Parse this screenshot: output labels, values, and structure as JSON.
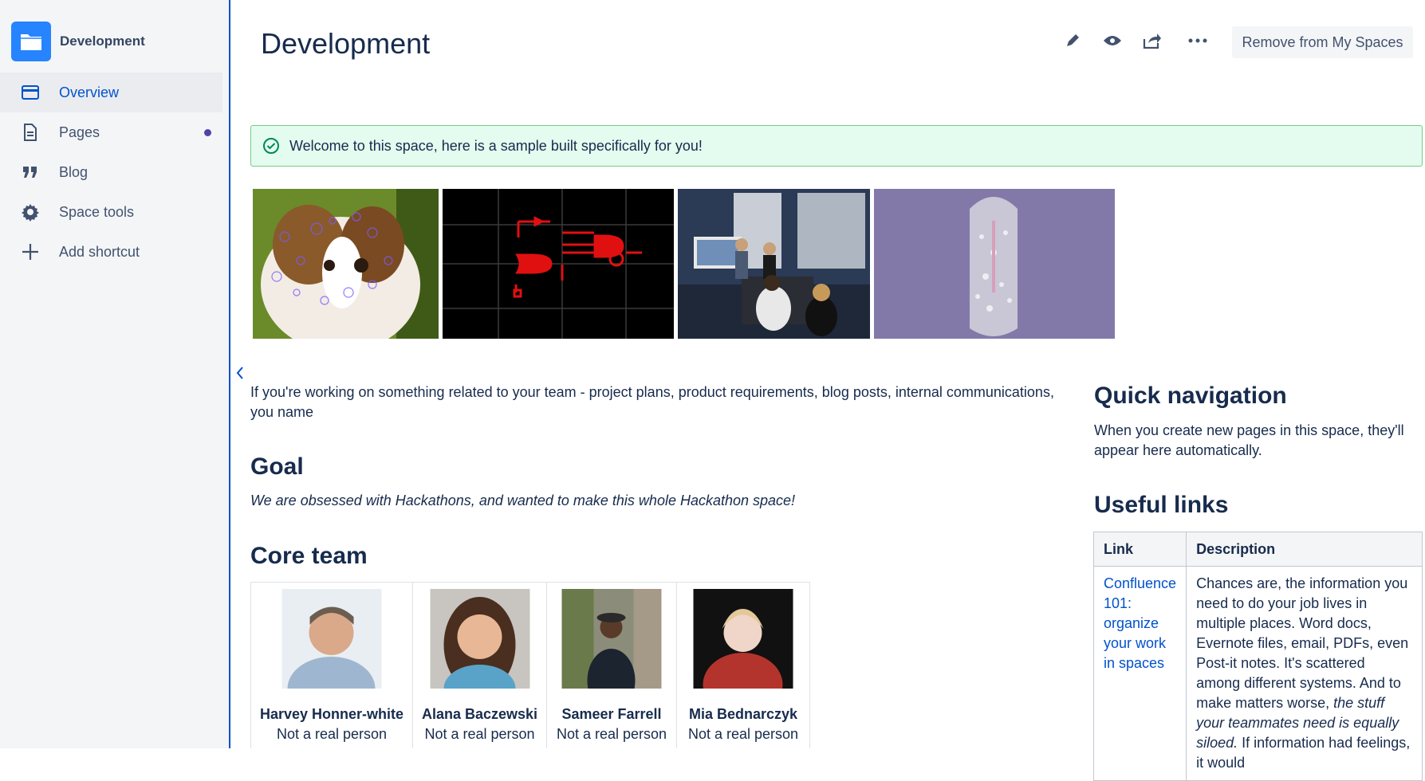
{
  "sidebar": {
    "space_name": "Development",
    "items": [
      {
        "label": "Overview",
        "icon": "overview-icon",
        "active": true
      },
      {
        "label": "Pages",
        "icon": "pages-icon",
        "has_dot": true
      },
      {
        "label": "Blog",
        "icon": "quote-icon"
      },
      {
        "label": "Space tools",
        "icon": "gear-icon"
      },
      {
        "label": "Add shortcut",
        "icon": "plus-icon"
      }
    ]
  },
  "header": {
    "title": "Development",
    "tools": [
      "edit-icon",
      "watch-icon",
      "share-icon",
      "more-icon"
    ],
    "remove_label": "Remove from My Spaces"
  },
  "banner": {
    "text": "Welcome to this space, here is a sample built specifically for you!"
  },
  "gallery": [
    {
      "name": "puppy-image"
    },
    {
      "name": "circuit-image"
    },
    {
      "name": "conference-image"
    },
    {
      "name": "capsule-image"
    }
  ],
  "content": {
    "intro": "If you're working on something related to your team - project plans, product requirements, blog posts, internal communications, you name",
    "goal_heading": "Goal",
    "goal_text": "We are obsessed with Hackathons, and wanted to make this whole Hackathon space!",
    "team_heading": "Core team",
    "team": [
      {
        "name": "Harvey Honner-white",
        "role": "Not a real person"
      },
      {
        "name": "Alana Baczewski",
        "role": "Not a real person"
      },
      {
        "name": "Sameer Farrell",
        "role": "Not a real person"
      },
      {
        "name": "Mia Bednarczyk",
        "role": "Not a real person"
      }
    ]
  },
  "right": {
    "quick_nav_heading": "Quick navigation",
    "quick_nav_text": "When you create new pages in this space, they'll appear here automatically.",
    "useful_links_heading": "Useful links",
    "table_headers": [
      "Link",
      "Description"
    ],
    "rows": [
      {
        "link": "Confluence 101: organize your work in spaces",
        "desc_a": "Chances are, the information you need to do your job lives in multiple places. Word docs, Evernote files, email, PDFs, even Post-it notes. It's scattered among different systems. And to make matters worse,",
        "desc_em": "the stuff your teammates need is equally siloed.",
        "desc_b": "If information had feelings, it would"
      }
    ]
  },
  "colors": {
    "accent": "#0052cc",
    "space_logo": "#2684ff",
    "banner_bg": "#e3fcef",
    "banner_border": "#79c98a",
    "success_icon": "#00875a",
    "pages_dot": "#5243aa"
  }
}
